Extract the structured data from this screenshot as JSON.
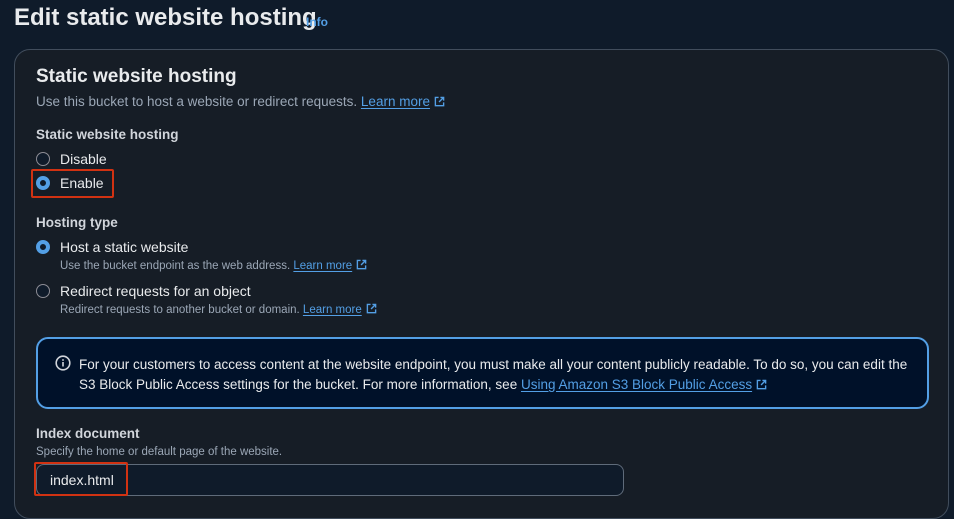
{
  "page": {
    "title": "Edit static website hosting",
    "info_label": "Info"
  },
  "section": {
    "title": "Static website hosting",
    "description": "Use this bucket to host a website or redirect requests.",
    "learn_more": "Learn more"
  },
  "hosting": {
    "label": "Static website hosting",
    "options": [
      {
        "label": "Disable",
        "selected": false
      },
      {
        "label": "Enable",
        "selected": true
      }
    ]
  },
  "hosting_type": {
    "label": "Hosting type",
    "options": [
      {
        "label": "Host a static website",
        "description": "Use the bucket endpoint as the web address.",
        "learn_more": "Learn more",
        "selected": true
      },
      {
        "label": "Redirect requests for an object",
        "description": "Redirect requests to another bucket or domain.",
        "learn_more": "Learn more",
        "selected": false
      }
    ]
  },
  "alert": {
    "text": "For your customers to access content at the website endpoint, you must make all your content publicly readable. To do so, you can edit the S3 Block Public Access settings for the bucket. For more information, see",
    "link": "Using Amazon S3 Block Public Access"
  },
  "index_document": {
    "label": "Index document",
    "description": "Specify the home or default page of the website.",
    "value": "index.html"
  },
  "colors": {
    "accent": "#539fe5",
    "highlight": "#d13212",
    "background": "#0f1b2a"
  },
  "icons": [
    "external-link-icon",
    "info-circle-icon"
  ]
}
